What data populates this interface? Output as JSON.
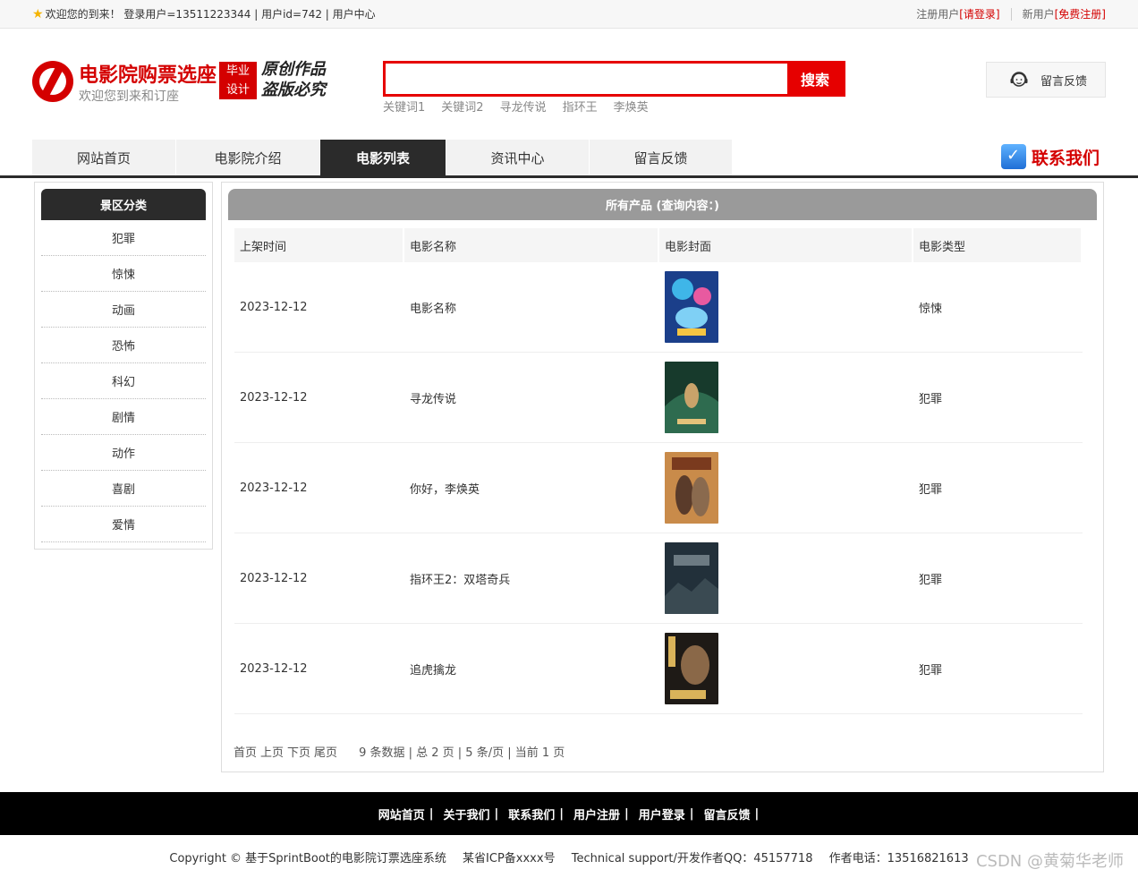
{
  "topbar": {
    "welcome": "欢迎您的到来！ 登录用户=13511223344 | 用户id=742 | 用户中心",
    "register_user_label": "注册用户",
    "login_link": "[请登录]",
    "new_user_label": "新用户",
    "register_link": "[免费注册]"
  },
  "header": {
    "site_title": "电影院购票选座",
    "site_subtitle": "欢迎您到来和订座",
    "badge_line1": "毕业",
    "badge_line2": "设计",
    "slogan_line1": "原创作品",
    "slogan_line2": "盗版必究",
    "search_value": "",
    "search_button": "搜索",
    "keywords": [
      "关键词1",
      "关键词2",
      "寻龙传说",
      "指环王",
      "李焕英"
    ],
    "feedback_label": "留言反馈"
  },
  "nav": {
    "items": [
      "网站首页",
      "电影院介绍",
      "电影列表",
      "资讯中心",
      "留言反馈"
    ],
    "active_index": 2,
    "contact_label": "联系我们"
  },
  "sidebar": {
    "title": "景区分类",
    "categories": [
      "犯罪",
      "惊悚",
      "动画",
      "恐怖",
      "科幻",
      "剧情",
      "动作",
      "喜剧",
      "爱情"
    ]
  },
  "main": {
    "title": "所有产品 (查询内容：)",
    "columns": [
      "上架时间",
      "电影名称",
      "电影封面",
      "电影类型"
    ],
    "rows": [
      {
        "date": "2023-12-12",
        "name": "电影名称",
        "type": "惊悚"
      },
      {
        "date": "2023-12-12",
        "name": "寻龙传说",
        "type": "犯罪"
      },
      {
        "date": "2023-12-12",
        "name": "你好，李焕英",
        "type": "犯罪"
      },
      {
        "date": "2023-12-12",
        "name": "指环王2：双塔奇兵",
        "type": "犯罪"
      },
      {
        "date": "2023-12-12",
        "name": "追虎擒龙",
        "type": "犯罪"
      }
    ],
    "pager": {
      "first": "首页",
      "prev": "上页",
      "next": "下页",
      "last": "尾页",
      "info": "9 条数据 | 总 2 页 | 5 条/页 | 当前 1 页"
    }
  },
  "footer": {
    "links": [
      "网站首页",
      "关于我们",
      "联系我们",
      "用户注册",
      "用户登录",
      "留言反馈"
    ],
    "separator": "|",
    "copyright": "Copyright © 基于SprintBoot的电影院订票选座系统",
    "icp": "某省ICP备xxxx号",
    "support": "Technical support/开发作者QQ：45157718",
    "phone": "作者电话：13516821613",
    "watermark": "CSDN @黄菊华老师"
  },
  "colors": {
    "accent_red": "#e60000",
    "nav_dark": "#2b2b2b",
    "panel_gray": "#9a9a9a"
  }
}
